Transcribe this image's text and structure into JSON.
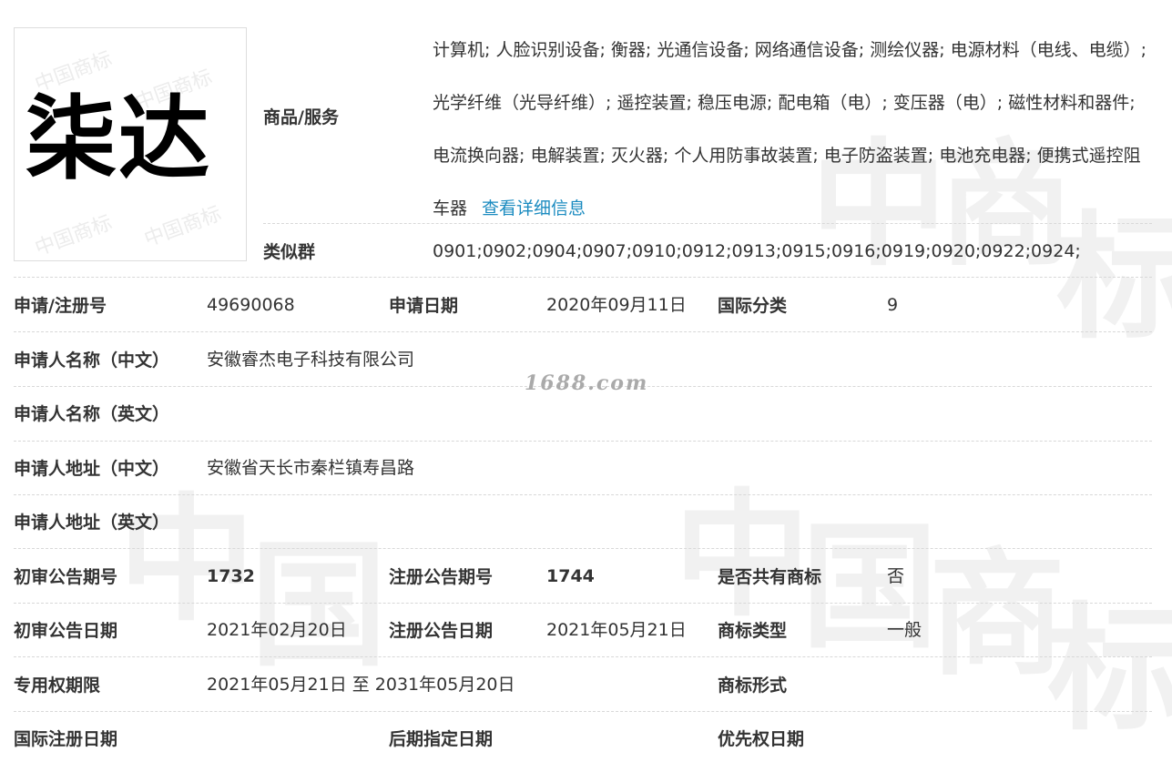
{
  "logo_text": "柒达",
  "logo_watermark": "中国商标",
  "watermark_chars": [
    "商",
    "标",
    "中",
    "国",
    "商",
    "标"
  ],
  "site_watermark": "1688.com",
  "goods": {
    "label": "商品/服务",
    "text": "计算机; 人脸识别设备; 衡器; 光通信设备; 网络通信设备; 测绘仪器; 电源材料（电线、电缆）; 光学纤维（光导纤维）; 遥控装置; 稳压电源; 配电箱（电）; 变压器（电）; 磁性材料和器件; 电流换向器; 电解装置; 灭火器; 个人用防事故装置; 电子防盗装置; 电池充电器; 便携式遥控阻车器",
    "link": "查看详细信息"
  },
  "similar": {
    "label": "类似群",
    "value": "0901;0902;0904;0907;0910;0912;0913;0915;0916;0919;0920;0922;0924;"
  },
  "rows": {
    "reg_no": {
      "label": "申请/注册号",
      "value": "49690068"
    },
    "apply_date": {
      "label": "申请日期",
      "value": "2020年09月11日"
    },
    "intl_class": {
      "label": "国际分类",
      "value": "9"
    },
    "name_cn": {
      "label": "申请人名称（中文）",
      "value": "安徽睿杰电子科技有限公司"
    },
    "name_en": {
      "label": "申请人名称（英文）",
      "value": ""
    },
    "addr_cn": {
      "label": "申请人地址（中文）",
      "value": "安徽省天长市秦栏镇寿昌路"
    },
    "addr_en": {
      "label": "申请人地址（英文）",
      "value": ""
    },
    "prelim_no": {
      "label": "初审公告期号",
      "value": "1732"
    },
    "reg_notice_no": {
      "label": "注册公告期号",
      "value": "1744"
    },
    "shared": {
      "label": "是否共有商标",
      "value": "否"
    },
    "prelim_date": {
      "label": "初审公告日期",
      "value": "2021年02月20日"
    },
    "reg_notice_date": {
      "label": "注册公告日期",
      "value": "2021年05月21日"
    },
    "tm_type": {
      "label": "商标类型",
      "value": "一般"
    },
    "term": {
      "label": "专用权期限",
      "value": "2021年05月21日 至 2031年05月20日"
    },
    "tm_form": {
      "label": "商标形式",
      "value": ""
    },
    "intl_reg_date": {
      "label": "国际注册日期",
      "value": ""
    },
    "later_date": {
      "label": "后期指定日期",
      "value": ""
    },
    "priority_date": {
      "label": "优先权日期",
      "value": ""
    }
  }
}
